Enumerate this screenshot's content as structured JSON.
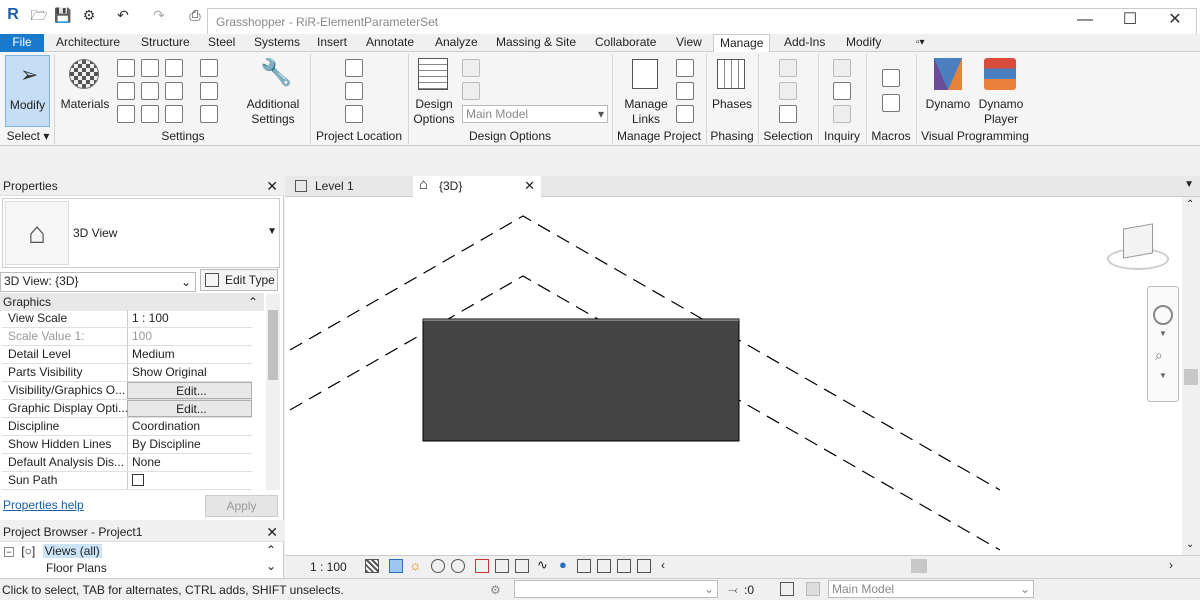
{
  "app": {
    "title": "Grasshopper - RiR-ElementParameterSet"
  },
  "tabs": [
    "File",
    "Architecture",
    "Structure",
    "Steel",
    "Systems",
    "Insert",
    "Annotate",
    "Analyze",
    "Massing & Site",
    "Collaborate",
    "View",
    "Manage",
    "Add-Ins",
    "Modify"
  ],
  "ribbon": {
    "modify": "Modify",
    "materials": "Materials",
    "additional1": "Additional",
    "additional2": "Settings",
    "design1": "Design",
    "design2": "Options",
    "main_model": "Main Model",
    "manage1": "Manage",
    "manage2": "Links",
    "phases": "Phases",
    "dynamo": "Dynamo",
    "dynamo_player1": "Dynamo",
    "dynamo_player2": "Player",
    "groups": {
      "select": "Select",
      "settings": "Settings",
      "project_location": "Project Location",
      "design_options": "Design Options",
      "manage_project": "Manage Project",
      "phasing": "Phasing",
      "selection": "Selection",
      "inquiry": "Inquiry",
      "macros": "Macros",
      "visual_programming": "Visual Programming"
    }
  },
  "properties": {
    "header": "Properties",
    "type_name": "3D View",
    "view_selector": "3D View: {3D}",
    "edit_type": "Edit Type",
    "section": "Graphics",
    "help": "Properties help",
    "apply": "Apply",
    "rows": [
      {
        "name": "View Scale",
        "value": "1 : 100"
      },
      {
        "name": "Scale Value    1:",
        "value": "100"
      },
      {
        "name": "Detail Level",
        "value": "Medium"
      },
      {
        "name": "Parts Visibility",
        "value": "Show Original"
      },
      {
        "name": "Visibility/Graphics O...",
        "value": "Edit..."
      },
      {
        "name": "Graphic Display Opti...",
        "value": "Edit..."
      },
      {
        "name": "Discipline",
        "value": "Coordination"
      },
      {
        "name": "Show Hidden Lines",
        "value": "By Discipline"
      },
      {
        "name": "Default Analysis Dis...",
        "value": "None"
      },
      {
        "name": "Sun Path",
        "value": ""
      }
    ]
  },
  "browser": {
    "header": "Project Browser - Project1",
    "views": "Views (all)",
    "floor_plans": "Floor Plans"
  },
  "view": {
    "tab1": "Level 1",
    "tab2": "{3D}",
    "scale": "1 : 100"
  },
  "status": {
    "hint": "Click to select, TAB for alternates, CTRL adds, SHIFT unselects.",
    "filter_count": ":0",
    "model": "Main Model"
  }
}
